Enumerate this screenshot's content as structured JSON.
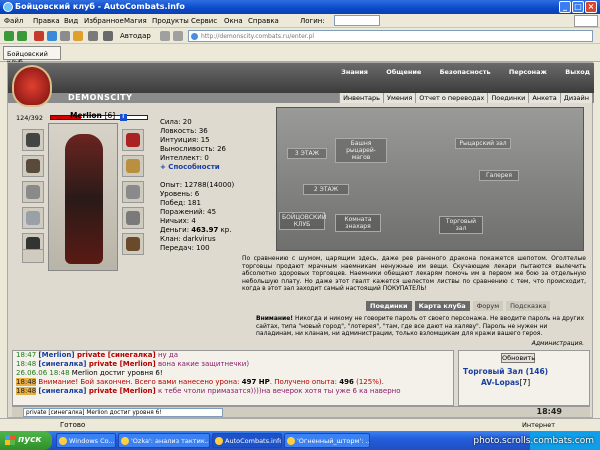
{
  "window": {
    "title": "Бойцовский клуб - AutoCombats.info",
    "min": "_",
    "max": "□",
    "close": "×"
  },
  "menu": {
    "items": [
      "Файл",
      "Правка",
      "Вид",
      "Избранное",
      "Магия",
      "Продукты",
      "Сервис",
      "Окна",
      "Справка"
    ],
    "login_label": "Логин:"
  },
  "toolbar": {
    "autofill_label": "Автодар",
    "url": "http://demonscity.combats.ru/enter.pl"
  },
  "tab": {
    "label": "Бойцовский клуб"
  },
  "site": {
    "logo": "DEMONSCITY",
    "top_nav": [
      "Знания",
      "Общение",
      "Безопасность",
      "Персонаж",
      "Выход"
    ],
    "sub_nav": [
      "Инвентарь",
      "Умения",
      "Отчет о переводах",
      "Поединки",
      "Анкета",
      "Дизайн"
    ]
  },
  "character": {
    "hp_text": "124/392",
    "hp_fraction": 0.316,
    "name": "Merlion",
    "level": "[6]",
    "info_icon": "i",
    "stats": [
      "Сила: 20",
      "Ловкость: 36",
      "Интуиция: 15",
      "Выносливость: 26",
      "Интеллект: 0"
    ],
    "abilities_link": "+ Способности",
    "details": [
      "Опыт: 12788(14000)",
      "Уровень: 6",
      "Побед: 181",
      "Поражений: 45",
      "Ничьих: 4"
    ],
    "money_label": "Деньги: ",
    "money_value": "463.97",
    "money_unit": " кр.",
    "clan": "Клан: darkvirus",
    "transfers": "Передач: 100"
  },
  "map": {
    "labels": {
      "floor3": "3 ЭТАЖ",
      "floor2": "2 ЭТАЖ",
      "club": "БОЙЦОВСКИЙ КЛУБ",
      "knights": "Башня рыцарей-магов",
      "knights_hall": "Рыцарский зал",
      "gallery": "Галерея",
      "beginners": "Комната знахаря",
      "throne": "Торговый зал"
    }
  },
  "notice_text": "По сравнению с шумом, царящим здесь, даже рев раненого дракона покажется шепотом. Оголтелые торговцы продают мрачным наемникам ненужные им вещи. Скучающие лекари пытаются вылечить абсолютно здоровых торговцев. Наемники обещают лекарям помочь им в первом же бою за отдельную небольшую плату. Но даже этот гвалт кажется шелестом листвы по сравнению с тем, что происходит, когда в этот зал заходит самый настоящий ПОКУПАТЕЛЬ!",
  "room_buttons": [
    "Поединки",
    "Карта клуба",
    "Форум",
    "Подсказка"
  ],
  "warning": {
    "bold": "Внимание!",
    "text": " Никогда и никому не говорите пароль от своего персонажа. Не вводите пароль на других сайтах, типа \"новый город\", \"лотерея\", \"там, где все дают на халяву\". Пароль не нужен ни паладинам, ни кланам, ни администрации, только взломщикам для кражи вашего героя.",
    "admin": "Администрация."
  },
  "chat": {
    "lines": [
      {
        "time": "18:47",
        "name": "[Merlion]",
        "private": " private [синегалка]",
        "text": " ну да",
        "highlight": false
      },
      {
        "time": "18:48",
        "name": "[синегалка]",
        "private": " private [Merlion]",
        "text": " вона какие защитнечки)",
        "highlight": false
      },
      {
        "time": "26.06.06 18:48",
        "name": "",
        "private": "",
        "text": "",
        "system_plain": " Merlion достиг уровня 6!",
        "highlight": false
      },
      {
        "time": "18:48",
        "name": "",
        "private": "",
        "text": "",
        "system_warn": " Внимание! Бой закончен. Всего вами нанесено урона: ",
        "dmg": "497 HP",
        "exp_label": ". Получено опыта: ",
        "exp": "496",
        "exp_pct": " (125%).",
        "highlight": true
      },
      {
        "time": "18:48",
        "name": "[синегалка]",
        "private": " private [Merlion]",
        "text": " к тебе чтоли примазатся))))на вечерок хотя ты уже 6 ка наверно",
        "highlight": true
      }
    ]
  },
  "side_panel": {
    "refresh": "Обновить",
    "room": "Торговый Зал (146)",
    "user_name": "AV-Lopas",
    "user_level": "[7]"
  },
  "input": {
    "value": "private [синегалка] Merlion достиг уровня 6!",
    "clock": "18:49"
  },
  "status": {
    "text": "Готово",
    "zone": "Интернет"
  },
  "taskbar": {
    "start": "пуск",
    "tasks": [
      "Windows Co...",
      "'Ozka': анализ тактик...",
      "AutoCombats.info",
      "'Огненный_шторм': ..."
    ]
  },
  "watermark": "photo.scrolls.combats.com",
  "colors": {
    "chat_time": "#1d7a1d",
    "chat_name": "#1a3ea0",
    "chat_private": "#b40000",
    "highlight": "#e8b040"
  }
}
